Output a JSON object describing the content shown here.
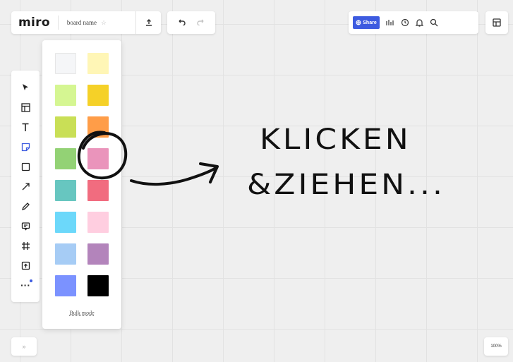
{
  "header": {
    "logo": "miro",
    "board_name": "board name",
    "share_label": "Share"
  },
  "colors": {
    "accent": "#3d5be0",
    "swatches": [
      "#f5f6f8",
      "#fff6b6",
      "#d5f692",
      "#f5d128",
      "#c9df56",
      "#ff9d48",
      "#93d275",
      "#ea94bb",
      "#67c6c0",
      "#f16c7f",
      "#6cd8fa",
      "#ffcee0",
      "#a6ccf5",
      "#b384bb",
      "#7b92ff",
      "#000000"
    ]
  },
  "toolbar": {
    "tools": [
      {
        "icon": "select-cursor-icon"
      },
      {
        "icon": "templates-icon"
      },
      {
        "icon": "text-icon"
      },
      {
        "icon": "sticky-note-icon",
        "active": true
      },
      {
        "icon": "shape-icon"
      },
      {
        "icon": "connection-line-icon"
      },
      {
        "icon": "pen-icon"
      },
      {
        "icon": "comment-icon"
      },
      {
        "icon": "frame-icon"
      },
      {
        "icon": "upload-icon"
      }
    ]
  },
  "color_panel": {
    "bulk_mode_label": "Bulk mode"
  },
  "zoom": {
    "level": "100%"
  },
  "annotation": {
    "line1": "KLICKEN",
    "line2": "&ZIEHEN..."
  }
}
